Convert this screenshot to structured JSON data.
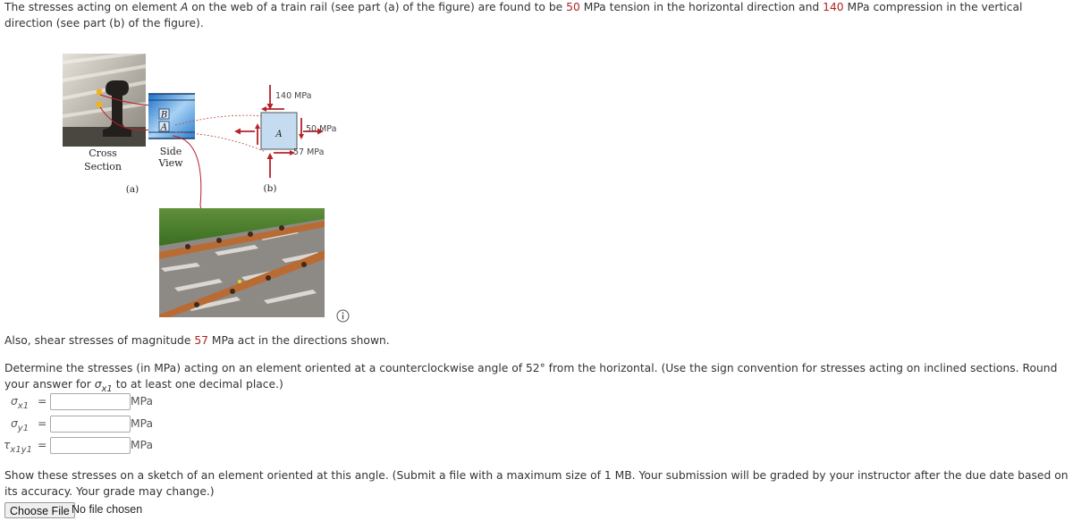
{
  "problem": {
    "intro": {
      "part1": "The stresses acting on element ",
      "element": "A",
      "part2": " on the web of a train rail (see part (a) of the figure) are found to be ",
      "tension_value": "50",
      "part3": " MPa tension in the horizontal direction and ",
      "compression_value": "140",
      "part4": " MPa compression in the vertical direction (see part (b) of the figure)."
    },
    "also": {
      "part1": "Also, shear stresses of magnitude ",
      "shear_value": "57",
      "part2": " MPa act in the directions shown."
    },
    "determine": {
      "part1": "Determine the stresses (in MPa) acting on an element oriented at a counterclockwise angle of 52° from the horizontal. (Use the sign convention for stresses acting on inclined sections. Round your answer for ",
      "symbol": "σ",
      "subscript": "x1",
      "part2": " to at least one decimal place.)"
    },
    "show": "Show these stresses on a sketch of an element oriented at this angle. (Submit a file with a maximum size of 1 MB. Your submission will be graded by your instructor after the due date based on its accuracy. Your grade may change.)"
  },
  "figure": {
    "cross_section_label_1": "Cross",
    "cross_section_label_2": "Section",
    "side_view_label_1": "Side",
    "side_view_label_2": "View",
    "part_a_label": "(a)",
    "part_b_label": "(b)",
    "element_b": "B",
    "element_a": "A",
    "stress_vertical": "140 MPa",
    "stress_horizontal": "50 MPa",
    "stress_shear": "57 MPa",
    "info_icon": "info-icon"
  },
  "answers": [
    {
      "symbol": "σ",
      "subscript": "x1",
      "eq": "=",
      "value": "",
      "unit": "MPa"
    },
    {
      "symbol": "σ",
      "subscript": "y1",
      "eq": "=",
      "value": "",
      "unit": "MPa"
    },
    {
      "symbol": "τ",
      "subscript": "x1y1",
      "eq": "=",
      "value": "",
      "unit": "MPa"
    }
  ],
  "upload": {
    "button_label": "Choose File",
    "status": "No file chosen"
  },
  "colors": {
    "highlight": "#b22222",
    "arrow": "#b5222a",
    "element_fill": "#c5dcf0"
  }
}
